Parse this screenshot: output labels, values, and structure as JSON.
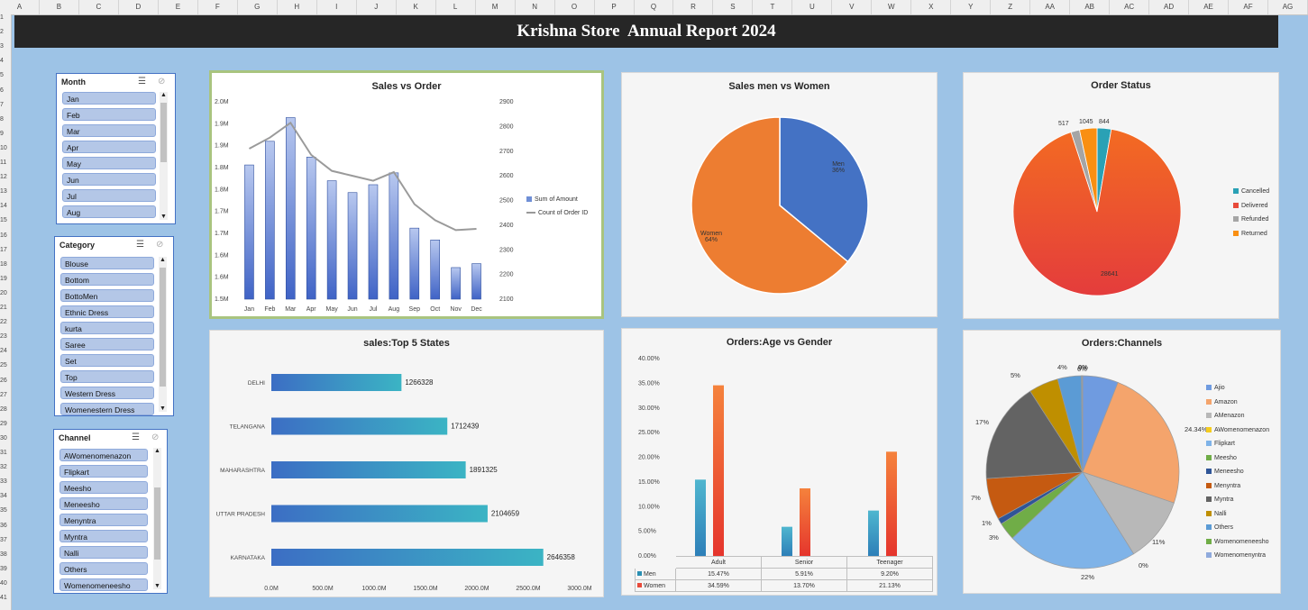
{
  "sheet": {
    "columns": [
      "A",
      "B",
      "C",
      "D",
      "E",
      "F",
      "G",
      "H",
      "I",
      "J",
      "K",
      "L",
      "M",
      "N",
      "O",
      "P",
      "Q",
      "R",
      "S",
      "T",
      "U",
      "V",
      "W",
      "X",
      "Y",
      "Z",
      "AA",
      "AB",
      "AC",
      "AD",
      "AE",
      "AF",
      "AG"
    ],
    "rows": [
      "1",
      "2",
      "3",
      "4",
      "5",
      "6",
      "7",
      "8",
      "9",
      "10",
      "11",
      "12",
      "13",
      "14",
      "15",
      "16",
      "17",
      "18",
      "19",
      "20",
      "21",
      "22",
      "23",
      "24",
      "25",
      "26",
      "27",
      "28",
      "29",
      "30",
      "31",
      "32",
      "33",
      "34",
      "35",
      "36",
      "37",
      "38",
      "39",
      "40",
      "41"
    ]
  },
  "banner": {
    "title": "Krishna Store  Annual Report 2024"
  },
  "slicers": {
    "month": {
      "header": "Month",
      "items": [
        "Jan",
        "Feb",
        "Mar",
        "Apr",
        "May",
        "Jun",
        "Jul",
        "Aug"
      ]
    },
    "category": {
      "header": "Category",
      "items": [
        "Blouse",
        "Bottom",
        "BottoMen",
        "Ethnic Dress",
        "kurta",
        "Saree",
        "Set",
        "Top",
        "Western Dress",
        "Womenestern Dress"
      ]
    },
    "channel": {
      "header": "Channel",
      "items": [
        "AWomenomenazon",
        "Flipkart",
        "Meesho",
        "Meneesho",
        "Menyntra",
        "Myntra",
        "Nalli",
        "Others",
        "Womenomeneesho"
      ]
    }
  },
  "charts": {
    "sales_order": {
      "title": "Sales vs Order",
      "y_left_ticks": [
        "2.0M",
        "1.9M",
        "1.9M",
        "1.8M",
        "1.8M",
        "1.7M",
        "1.7M",
        "1.6M",
        "1.6M",
        "1.5M"
      ],
      "y_right_ticks": [
        "2900",
        "2800",
        "2700",
        "2600",
        "2500",
        "2400",
        "2300",
        "2200",
        "2100"
      ],
      "legend": [
        "Sum of Amount",
        "Count of Order ID"
      ]
    },
    "gender": {
      "title": "Sales men vs Women",
      "labels": [
        {
          "name": "Men",
          "pct": "36%"
        },
        {
          "name": "Women",
          "pct": "64%"
        }
      ]
    },
    "status": {
      "title": "Order Status",
      "labels": [
        "517",
        "1045",
        "844",
        "28641"
      ],
      "legend": [
        "Cancelled",
        "Delivered",
        "Refunded",
        "Returned"
      ]
    },
    "states": {
      "title": "sales:Top 5 States",
      "x_ticks": [
        "0.0M",
        "500.0M",
        "1000.0M",
        "1500.0M",
        "2000.0M",
        "2500.0M",
        "3000.0M"
      ]
    },
    "age_gender": {
      "title": "Orders:Age vs Gender",
      "y_ticks": [
        "40.00%",
        "35.00%",
        "30.00%",
        "25.00%",
        "20.00%",
        "15.00%",
        "10.00%",
        "5.00%",
        "0.00%"
      ],
      "table": {
        "groups": [
          "Adult",
          "Senior",
          "Teenager"
        ],
        "rows": [
          {
            "name": "Men",
            "values": [
              "15.47%",
              "5.91%",
              "9.20%"
            ]
          },
          {
            "name": "Women",
            "values": [
              "34.59%",
              "13.70%",
              "21.13%"
            ]
          }
        ]
      }
    },
    "channels": {
      "title": "Orders:Channels",
      "labels": [
        "6%",
        "24.34%",
        "11%",
        "0%",
        "22%",
        "3%",
        "1%",
        "7%",
        "17%",
        "5%",
        "4%",
        "0%"
      ],
      "legend": [
        "Ajio",
        "Amazon",
        "AMenazon",
        "AWomenomenazon",
        "Flipkart",
        "Meesho",
        "Meneesho",
        "Menyntra",
        "Myntra",
        "Nalli",
        "Others",
        "Womenomeneesho",
        "Womenomenyntra"
      ]
    }
  },
  "chart_data": [
    {
      "type": "bar",
      "title": "Sales vs Order",
      "categories": [
        "Jan",
        "Feb",
        "Mar",
        "Apr",
        "May",
        "Jun",
        "Jul",
        "Aug",
        "Sep",
        "Oct",
        "Nov",
        "Dec"
      ],
      "series": [
        {
          "name": "Sum of Amount",
          "values": [
            1.84,
            1.9,
            1.96,
            1.86,
            1.8,
            1.77,
            1.79,
            1.82,
            1.68,
            1.65,
            1.58,
            1.59
          ]
        },
        {
          "name": "Count of Order ID",
          "type": "line",
          "axis": "right",
          "values": [
            2710,
            2755,
            2815,
            2685,
            2620,
            2600,
            2580,
            2615,
            2485,
            2420,
            2380,
            2385
          ]
        }
      ],
      "ylim": [
        1.5,
        2.0
      ],
      "y2lim": [
        2100,
        2900
      ]
    },
    {
      "type": "pie",
      "title": "Sales men vs Women",
      "labels": [
        "Men",
        "Women"
      ],
      "values": [
        36,
        64
      ],
      "colors": [
        "#4472c4",
        "#ed7d31"
      ]
    },
    {
      "type": "pie",
      "title": "Order Status",
      "labels": [
        "Cancelled",
        "Delivered",
        "Refunded",
        "Returned"
      ],
      "values": [
        844,
        28641,
        517,
        1045
      ],
      "colors": [
        "#2aa1b5",
        "#e84a3a",
        "#a5a5a5",
        "#f98f12"
      ]
    },
    {
      "type": "bar",
      "title": "sales:Top 5 States",
      "orientation": "horizontal",
      "categories": [
        "DELHI",
        "TELANGANA",
        "MAHARASHTRA",
        "UTTAR PRADESH",
        "KARNATAKA"
      ],
      "values": [
        1266328,
        1712439,
        1891325,
        2104659,
        2646358
      ],
      "xlim": [
        0,
        3000000
      ]
    },
    {
      "type": "bar",
      "title": "Orders:Age vs Gender",
      "categories": [
        "Adult",
        "Senior",
        "Teenager"
      ],
      "series": [
        {
          "name": "Men",
          "values": [
            15.47,
            5.91,
            9.2
          ]
        },
        {
          "name": "Women",
          "values": [
            34.59,
            13.7,
            21.13
          ]
        }
      ],
      "ylim": [
        0,
        40
      ]
    },
    {
      "type": "pie",
      "title": "Orders:Channels",
      "labels": [
        "Ajio",
        "Amazon",
        "AMenazon",
        "AWomenomenazon",
        "Flipkart",
        "Meesho",
        "Meneesho",
        "Menyntra",
        "Myntra",
        "Nalli",
        "Others",
        "Womenomeneesho",
        "Womenomenyntra"
      ],
      "values": [
        6,
        24.34,
        11,
        0,
        22,
        3,
        1,
        7,
        17,
        5,
        4,
        0.1,
        0.1
      ],
      "colors": [
        "#6f9be0",
        "#f4a46c",
        "#b8b8b8",
        "#f5cc1f",
        "#7fb3e8",
        "#70ad47",
        "#2f5597",
        "#c55a11",
        "#636363",
        "#bf8f00",
        "#5b9bd5",
        "#70ad47",
        "#8faadc"
      ]
    }
  ]
}
